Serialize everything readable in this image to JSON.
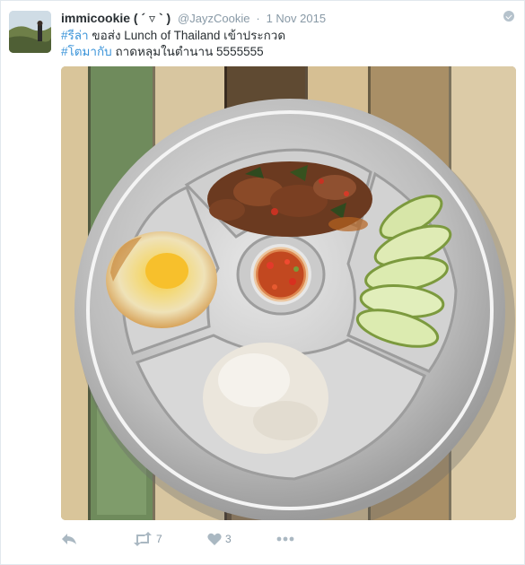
{
  "tweet": {
    "name": "immicookie ( ´ ▿ ` )",
    "handle": "@JayzCookie",
    "separator": "·",
    "time": "1 Nov 2015",
    "line1_hashtag": "#รีล่า",
    "line1_text": " ขอส่ง Lunch of Thailand เข้าประกวด",
    "line2_hashtag": "#โตมากับ",
    "line2_text": " ถาดหลุมในตำนาน 5555555",
    "photo_subject": "Thai lunch on a round stainless steel compartment tray: pork basil stir-fry, fried egg, chili fish sauce, cucumber slices and rice",
    "retweet_count": "7",
    "like_count": "3"
  },
  "icons": {
    "reply": "reply-icon",
    "retweet": "retweet-icon",
    "like": "heart-icon",
    "more": "more-dots-icon",
    "caret": "caret-down-icon"
  },
  "colors": {
    "link": "#3b94d9",
    "meta_grey": "#8899a6",
    "icon_grey": "#aab8c2"
  }
}
